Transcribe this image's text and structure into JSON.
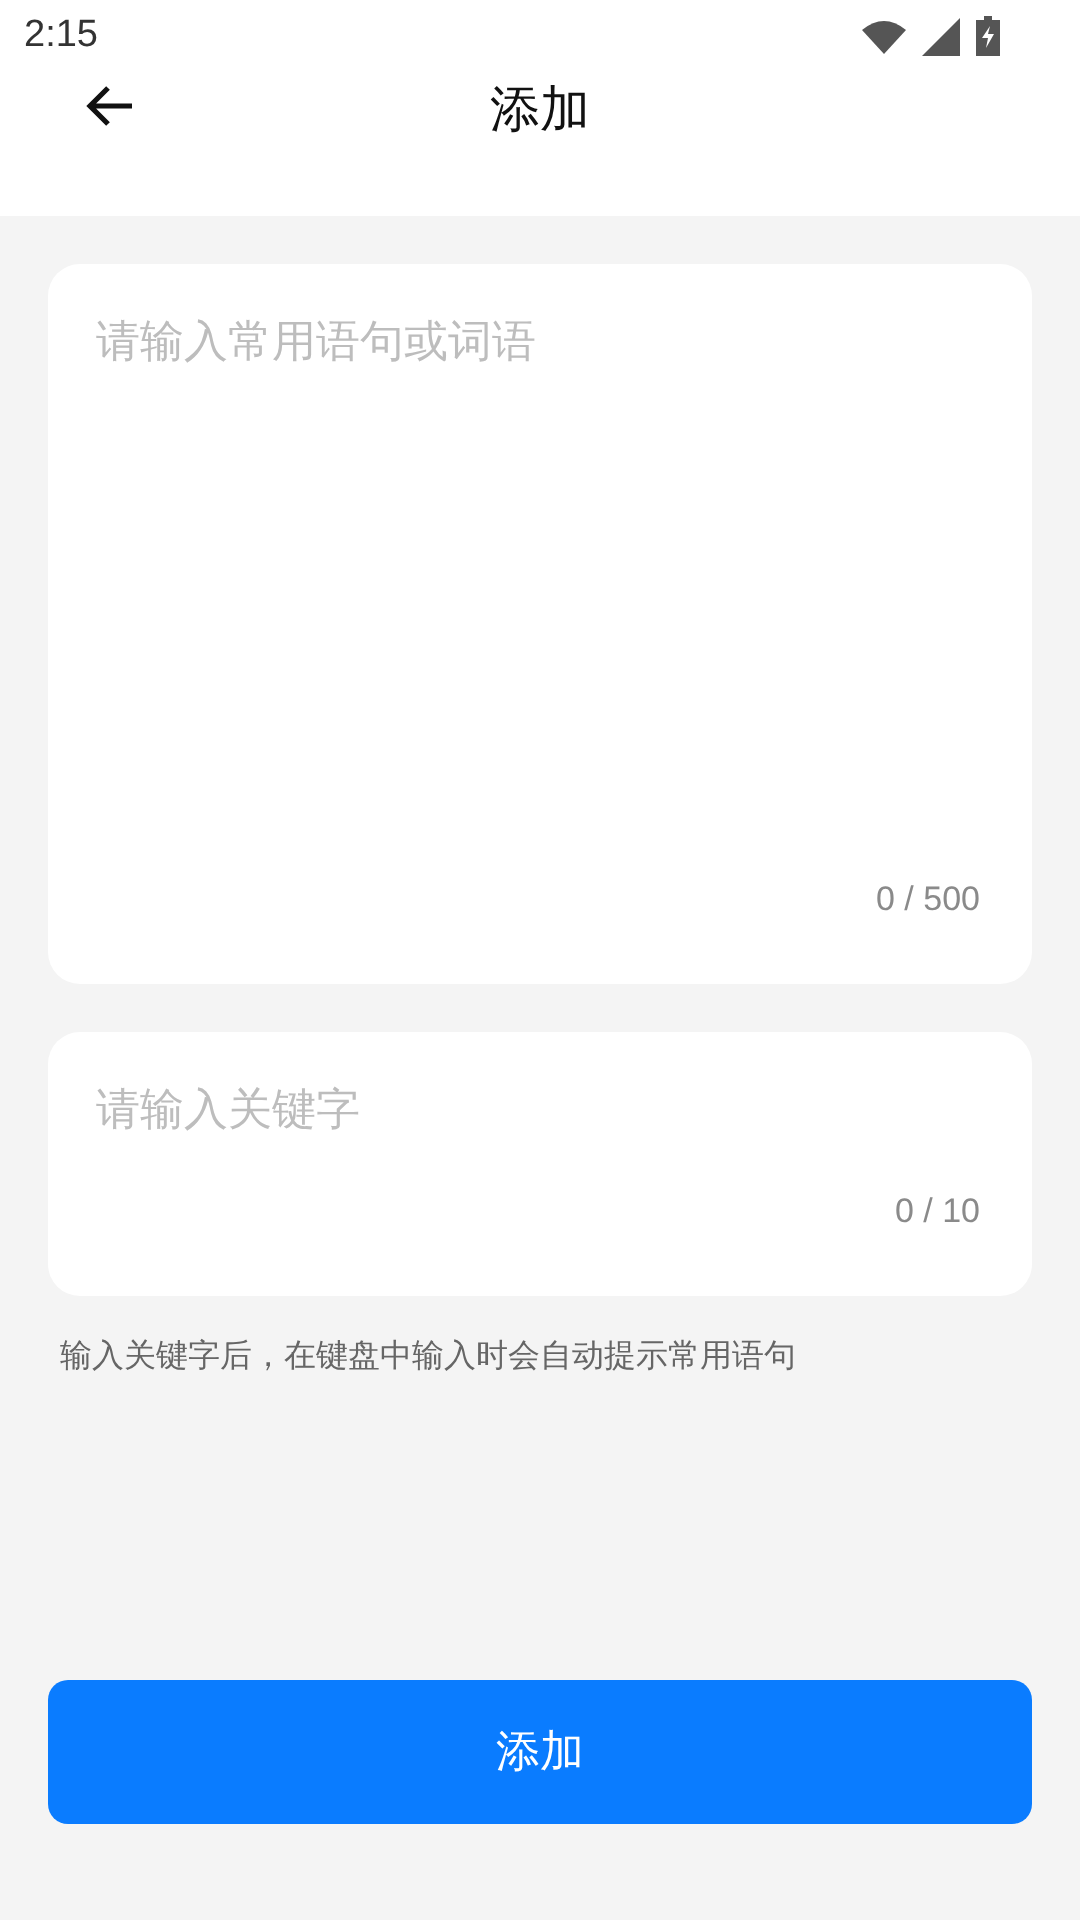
{
  "status_bar": {
    "time": "2:15"
  },
  "header": {
    "title": "添加"
  },
  "phrase_field": {
    "placeholder": "请输入常用语句或词语",
    "counter": "0 / 500"
  },
  "keyword_field": {
    "placeholder": "请输入关键字",
    "counter": "0 / 10"
  },
  "hint": "输入关键字后，在键盘中输入时会自动提示常用语句",
  "submit_button": {
    "label": "添加"
  }
}
